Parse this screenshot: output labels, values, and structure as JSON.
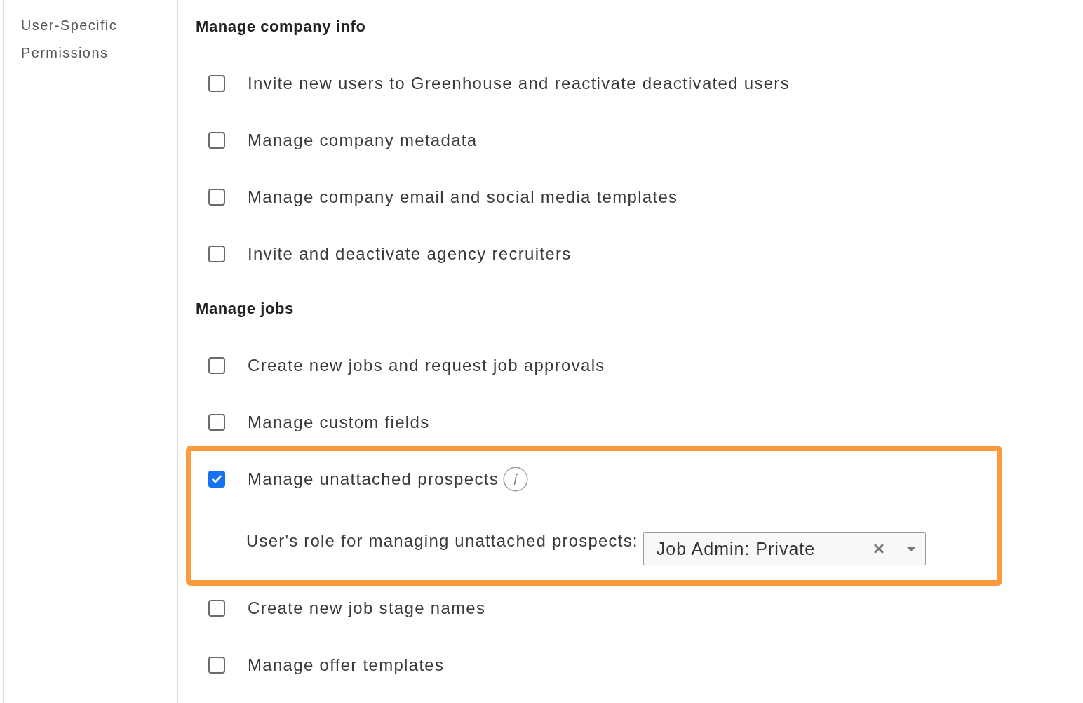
{
  "sidebar": {
    "label": "User-Specific Permissions"
  },
  "sections": [
    {
      "heading": "Manage company info",
      "permissions": [
        {
          "label": "Invite new users to Greenhouse and reactivate deactivated users",
          "checked": false
        },
        {
          "label": "Manage company metadata",
          "checked": false
        },
        {
          "label": "Manage company email and social media templates",
          "checked": false
        },
        {
          "label": "Invite and deactivate agency recruiters",
          "checked": false
        }
      ]
    },
    {
      "heading": "Manage jobs",
      "permissions": [
        {
          "label": "Create new jobs and request job approvals",
          "checked": false
        },
        {
          "label": "Manage custom fields",
          "checked": false
        },
        {
          "label": "Manage unattached prospects",
          "checked": true,
          "highlighted": true,
          "info": true,
          "role_field": {
            "label": "User's role for managing unattached prospects:",
            "value": "Job Admin: Private"
          }
        },
        {
          "label": "Create new job stage names",
          "checked": false
        },
        {
          "label": "Manage offer templates",
          "checked": false
        }
      ]
    }
  ]
}
